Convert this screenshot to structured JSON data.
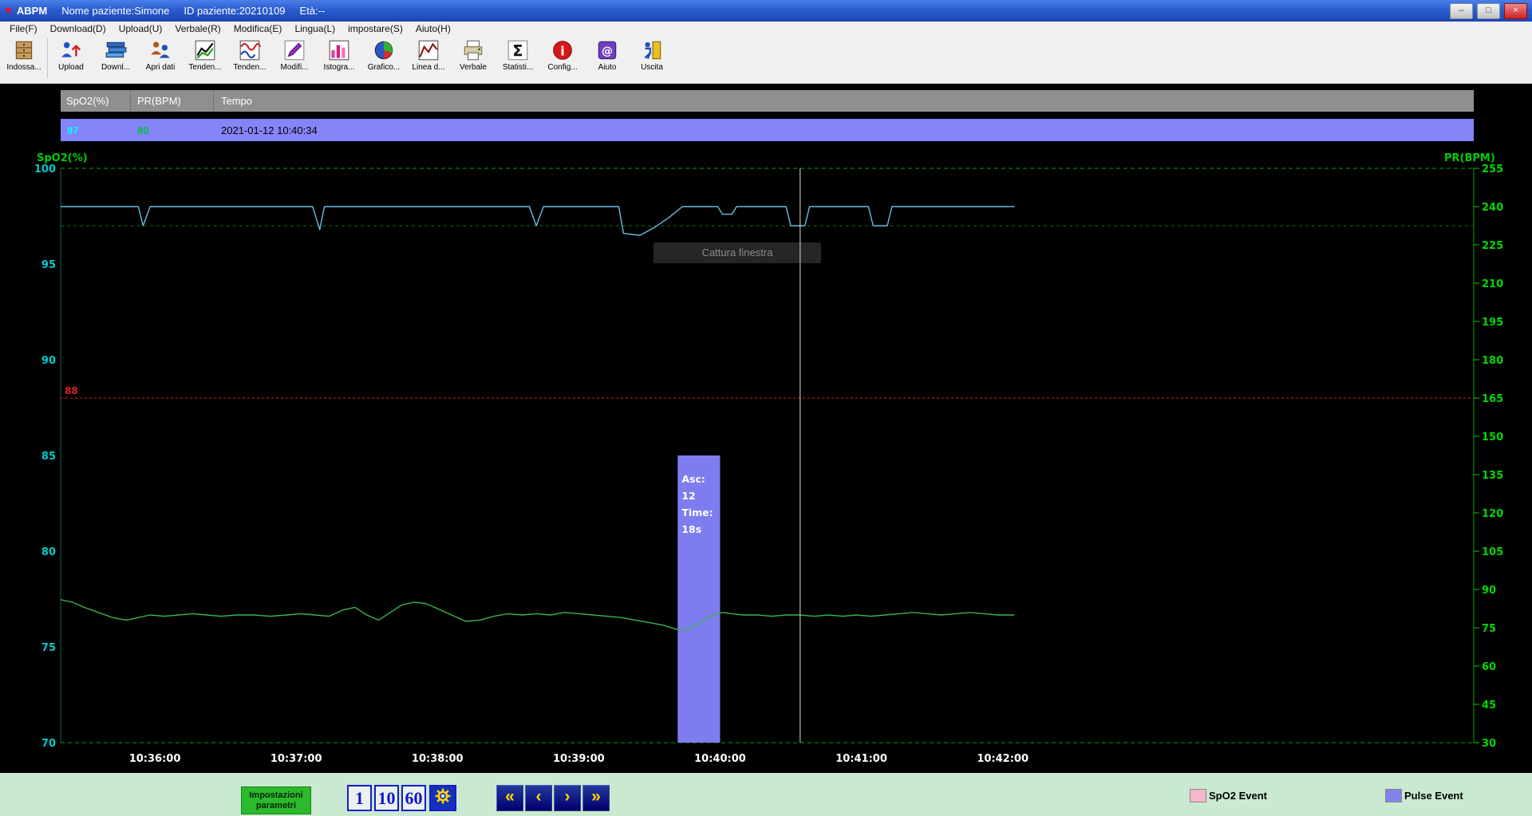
{
  "window": {
    "title_app": "ABPM",
    "patient_name_label": "Nome paziente:Simone",
    "patient_id_label": "ID paziente:20210109",
    "age_label": "Età:--",
    "controls": {
      "minimize": "–",
      "maximize": "□",
      "close": "×"
    }
  },
  "menu": {
    "items": [
      "File(F)",
      "Download(D)",
      "Upload(U)",
      "Verbale(R)",
      "Modifica(E)",
      "Lingua(L)",
      "impostare(S)",
      "Aiuto(H)"
    ]
  },
  "toolbar": {
    "items": [
      {
        "label": "Indossa...",
        "icon": "wear-device-icon"
      },
      {
        "label": "Upload",
        "icon": "upload-icon"
      },
      {
        "label": "Downl...",
        "icon": "download-icon"
      },
      {
        "label": "Apri dati",
        "icon": "open-data-icon"
      },
      {
        "label": "Tenden...",
        "icon": "trend-table-icon"
      },
      {
        "label": "Tenden...",
        "icon": "trend-graph-icon"
      },
      {
        "label": "Modifi...",
        "icon": "edit-icon"
      },
      {
        "label": "Istogra...",
        "icon": "histogram-icon"
      },
      {
        "label": "Grafico...",
        "icon": "pie-chart-icon"
      },
      {
        "label": "Linea d...",
        "icon": "line-chart-icon"
      },
      {
        "label": "Verbale",
        "icon": "report-icon"
      },
      {
        "label": "Statisti...",
        "icon": "statistics-icon"
      },
      {
        "label": "Config...",
        "icon": "config-icon"
      },
      {
        "label": "Aiuto",
        "icon": "help-icon"
      },
      {
        "label": "Uscita",
        "icon": "exit-icon"
      }
    ]
  },
  "table": {
    "headers": [
      "SpO2(%)",
      "PR(BPM)",
      "Tempo"
    ],
    "selected_row": {
      "spo2": "97",
      "pr": "80",
      "time": "2021-01-12 10:40:34"
    }
  },
  "chart_data": {
    "type": "line",
    "x_axis": {
      "tmin": 0,
      "tmax": 600,
      "start_time": "10:35:20",
      "ticks": [
        {
          "t": 40,
          "label": "10:36:00"
        },
        {
          "t": 100,
          "label": "10:37:00"
        },
        {
          "t": 160,
          "label": "10:38:00"
        },
        {
          "t": 220,
          "label": "10:39:00"
        },
        {
          "t": 280,
          "label": "10:40:00"
        },
        {
          "t": 340,
          "label": "10:41:00"
        },
        {
          "t": 400,
          "label": "10:42:00"
        }
      ]
    },
    "left_axis": {
      "label": "SpO2(%)",
      "min": 70,
      "max": 100,
      "ticks": [
        100,
        95,
        90,
        85,
        80,
        75,
        70
      ],
      "tick_color": "#00cccc",
      "label_color": "#00cc00"
    },
    "right_axis": {
      "label": "PR(BPM)",
      "min": 30,
      "max": 255,
      "ticks": [
        255,
        240,
        225,
        210,
        195,
        180,
        165,
        150,
        135,
        120,
        105,
        90,
        75,
        60,
        45,
        30
      ],
      "tick_color": "#00d800",
      "label_color": "#00cc00"
    },
    "x_tick_color": "#ffffff",
    "frame_color": "#00aa00",
    "guide_line": {
      "axis": "left",
      "value": 97,
      "color": "#00a000",
      "style": "dashed"
    },
    "alarm_line": {
      "axis": "left",
      "value": 88,
      "label": "88",
      "color": "#e02020",
      "style": "dashed"
    },
    "cursor": {
      "t": 314,
      "time": "10:40:34",
      "color": "#e2e2cc"
    },
    "pulse_event_bar": {
      "t_start": 262,
      "t_end": 280,
      "top_value": 85,
      "color": "#7d7df0",
      "text_lines": [
        "Asc:",
        "12",
        "Time:",
        "18s"
      ]
    },
    "series": [
      {
        "name": "SpO2",
        "axis": "left",
        "color": "#68bede",
        "points": [
          [
            0,
            98
          ],
          [
            33,
            98
          ],
          [
            35,
            97
          ],
          [
            38,
            98
          ],
          [
            107,
            98
          ],
          [
            110,
            96.8
          ],
          [
            112,
            98
          ],
          [
            199,
            98
          ],
          [
            202,
            97
          ],
          [
            205,
            98
          ],
          [
            237,
            98
          ],
          [
            239,
            96.6
          ],
          [
            246,
            96.5
          ],
          [
            252,
            96.9
          ],
          [
            258,
            97.4
          ],
          [
            264,
            98
          ],
          [
            279,
            98
          ],
          [
            281,
            97.6
          ],
          [
            285,
            97.6
          ],
          [
            287,
            98
          ],
          [
            308,
            98
          ],
          [
            310,
            97
          ],
          [
            316,
            97
          ],
          [
            318,
            98
          ],
          [
            343,
            98
          ],
          [
            345,
            97
          ],
          [
            351,
            97
          ],
          [
            353,
            98
          ],
          [
            405,
            98
          ]
        ]
      },
      {
        "name": "PR",
        "axis": "right",
        "color": "#38b44c",
        "points": [
          [
            0,
            86
          ],
          [
            5,
            85
          ],
          [
            10,
            83
          ],
          [
            16,
            81
          ],
          [
            22,
            79
          ],
          [
            28,
            78
          ],
          [
            33,
            79
          ],
          [
            38,
            80
          ],
          [
            44,
            79.5
          ],
          [
            50,
            80
          ],
          [
            56,
            80.5
          ],
          [
            62,
            80
          ],
          [
            68,
            79.5
          ],
          [
            75,
            80
          ],
          [
            82,
            80
          ],
          [
            89,
            79.5
          ],
          [
            96,
            80
          ],
          [
            102,
            80.5
          ],
          [
            108,
            80
          ],
          [
            114,
            79.5
          ],
          [
            120,
            82
          ],
          [
            125,
            83
          ],
          [
            130,
            80
          ],
          [
            135,
            78
          ],
          [
            140,
            81
          ],
          [
            145,
            84
          ],
          [
            150,
            85
          ],
          [
            155,
            84.5
          ],
          [
            160,
            82.5
          ],
          [
            166,
            80
          ],
          [
            172,
            77.5
          ],
          [
            178,
            78
          ],
          [
            184,
            79.5
          ],
          [
            190,
            80.5
          ],
          [
            196,
            80
          ],
          [
            202,
            80.5
          ],
          [
            208,
            80
          ],
          [
            214,
            81
          ],
          [
            220,
            80.5
          ],
          [
            226,
            80
          ],
          [
            232,
            79.5
          ],
          [
            238,
            79
          ],
          [
            244,
            78
          ],
          [
            250,
            77
          ],
          [
            256,
            76
          ],
          [
            261,
            74.5
          ],
          [
            265,
            74
          ],
          [
            269,
            75.5
          ],
          [
            273,
            78
          ],
          [
            277,
            80
          ],
          [
            281,
            81
          ],
          [
            285,
            80.5
          ],
          [
            290,
            80
          ],
          [
            296,
            80
          ],
          [
            302,
            79.5
          ],
          [
            308,
            80
          ],
          [
            314,
            80
          ],
          [
            320,
            79.5
          ],
          [
            326,
            80
          ],
          [
            332,
            79.5
          ],
          [
            338,
            80
          ],
          [
            344,
            79.5
          ],
          [
            350,
            80
          ],
          [
            356,
            80.5
          ],
          [
            362,
            81
          ],
          [
            368,
            80.5
          ],
          [
            374,
            80
          ],
          [
            380,
            80.5
          ],
          [
            386,
            81
          ],
          [
            392,
            80.5
          ],
          [
            398,
            80
          ],
          [
            405,
            80
          ]
        ]
      }
    ],
    "capture_overlay_text": "Cattura finestra"
  },
  "footer": {
    "param_button_line1": "Impostazioni",
    "param_button_line2": "parametri",
    "interval_buttons": [
      "1",
      "10",
      "60"
    ],
    "nav_buttons": [
      "«",
      "‹",
      "›",
      "»"
    ],
    "legend": [
      {
        "label": "SpO2 Event",
        "color": "#f2b8cb"
      },
      {
        "label": "Pulse Event",
        "color": "#8282ee"
      }
    ]
  }
}
